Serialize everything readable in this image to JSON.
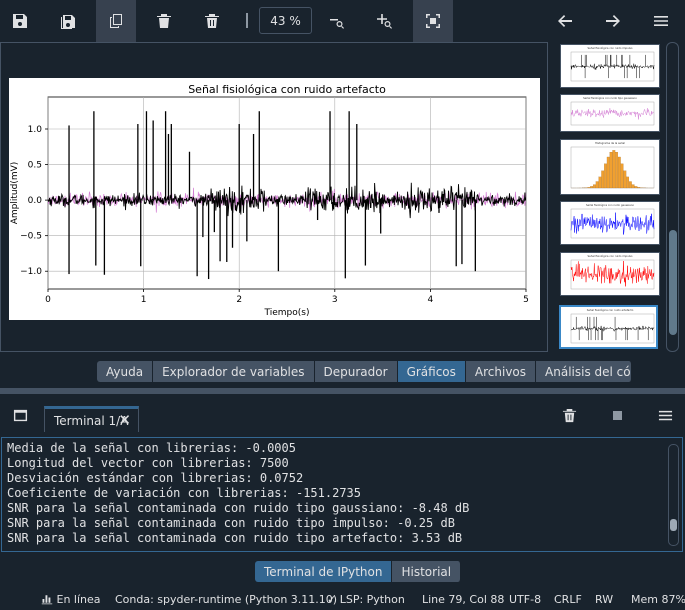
{
  "toolbar": {
    "zoom": "43 %"
  },
  "figure": {
    "title": "Señal fisiológica con ruido artefacto",
    "xlabel": "Tiempo(s)",
    "ylabel": "Amplitud(mV)",
    "xticks": [
      "0",
      "1",
      "2",
      "3",
      "4",
      "5"
    ],
    "yticks": [
      "1.0",
      "0.5",
      "0.0",
      "−0.5",
      "−1.0"
    ]
  },
  "chart_data": {
    "type": "line",
    "title": "Señal fisiológica con ruido artefacto",
    "xlabel": "Tiempo(s)",
    "ylabel": "Amplitud(mV)",
    "xlim": [
      0,
      5
    ],
    "ylim": [
      -1.25,
      1.45
    ],
    "grid": true,
    "series": [
      {
        "color": "#000000",
        "baseline": 0.0,
        "noise_std": 0.04,
        "spikes": [
          {
            "t": 0.22,
            "v": 1.05
          },
          {
            "t": 0.22,
            "v": -1.04
          },
          {
            "t": 0.48,
            "v": 1.25
          },
          {
            "t": 0.5,
            "v": -0.92
          },
          {
            "t": 0.94,
            "v": 1.07
          },
          {
            "t": 0.97,
            "v": -0.93
          },
          {
            "t": 1.03,
            "v": 1.25
          },
          {
            "t": 1.1,
            "v": 1.12
          },
          {
            "t": 1.23,
            "v": 1.25
          },
          {
            "t": 1.29,
            "v": 1.07
          },
          {
            "t": 1.26,
            "v": 0.93
          },
          {
            "t": 1.48,
            "v": 0.68
          },
          {
            "t": 1.62,
            "v": -0.52
          },
          {
            "t": 1.74,
            "v": -0.45
          },
          {
            "t": 2.15,
            "v": 0.93
          },
          {
            "t": 2.21,
            "v": 1.25
          },
          {
            "t": 2.0,
            "v": 1.07
          },
          {
            "t": 1.93,
            "v": -0.67
          },
          {
            "t": 2.08,
            "v": -0.58
          },
          {
            "t": 1.8,
            "v": -0.86
          },
          {
            "t": 1.87,
            "v": -0.87
          },
          {
            "t": 2.95,
            "v": 1.25
          },
          {
            "t": 3.15,
            "v": 1.25
          },
          {
            "t": 3.23,
            "v": 1.07
          },
          {
            "t": 3.32,
            "v": -0.92
          },
          {
            "t": 3.48,
            "v": -0.47
          },
          {
            "t": 2.82,
            "v": -0.28
          },
          {
            "t": 4.09,
            "v": -0.18
          },
          {
            "t": 4.27,
            "v": -0.93
          },
          {
            "t": 4.47,
            "v": -1.0
          },
          {
            "t": 1.56,
            "v": -1.07
          },
          {
            "t": 1.68,
            "v": -1.11
          },
          {
            "t": 2.41,
            "v": -1.0
          },
          {
            "t": 0.59,
            "v": -1.05
          },
          {
            "t": 3.11,
            "v": -1.1
          },
          {
            "t": 4.33,
            "v": -0.9
          }
        ]
      },
      {
        "color": "#d47fd4",
        "note_hidden": false,
        "noise_std": 0.05
      }
    ]
  },
  "thumbnails": [
    {
      "title": "Señal fisiológica con ruido impulso",
      "color": "#000000"
    },
    {
      "title": "Señal fisiológica con ruido tipo gaussiano",
      "color": "#d47fd4"
    },
    {
      "title": "Histograma de la señal",
      "color": "#f0a030"
    },
    {
      "title": "Señal fisiológica con ruido gaussiano",
      "color": "#0000ff"
    },
    {
      "title": "Señal fisiológica con ruido impulso",
      "color": "#ff0000"
    },
    {
      "title": "Señal fisiológica con ruido artefacto",
      "color": "#000000"
    }
  ],
  "pane_tabs": [
    "Ayuda",
    "Explorador de variables",
    "Depurador",
    "Gráficos",
    "Archivos",
    "Análisis del código"
  ],
  "pane_tab_selected": "Gráficos",
  "console": {
    "tab_label": "Terminal 1/A",
    "lines": [
      "Media de la señal con librerias: -0.0005",
      "Longitud del vector con librerias: 7500",
      "Desviación estándar con librerias: 0.0752",
      "Coeficiente de variación con librerias: -151.2735",
      "SNR para la señal contaminada con ruido tipo gaussiano: -8.48 dB",
      "SNR para la señal contaminada con ruido tipo impulso: -0.25 dB",
      "SNR para la señal contaminada con ruido tipo artefacto: 3.53 dB"
    ]
  },
  "console_tabs": [
    "Terminal de IPython",
    "Historial"
  ],
  "console_tab_selected": "Terminal de IPython",
  "status": {
    "online": "En línea",
    "conda": "Conda: spyder-runtime (Python 3.11.10)",
    "lsp": "LSP: Python",
    "position": "Line 79, Col 88",
    "encoding": "UTF-8",
    "eol": "CRLF",
    "mode": "RW",
    "memory": "Mem 87%"
  }
}
